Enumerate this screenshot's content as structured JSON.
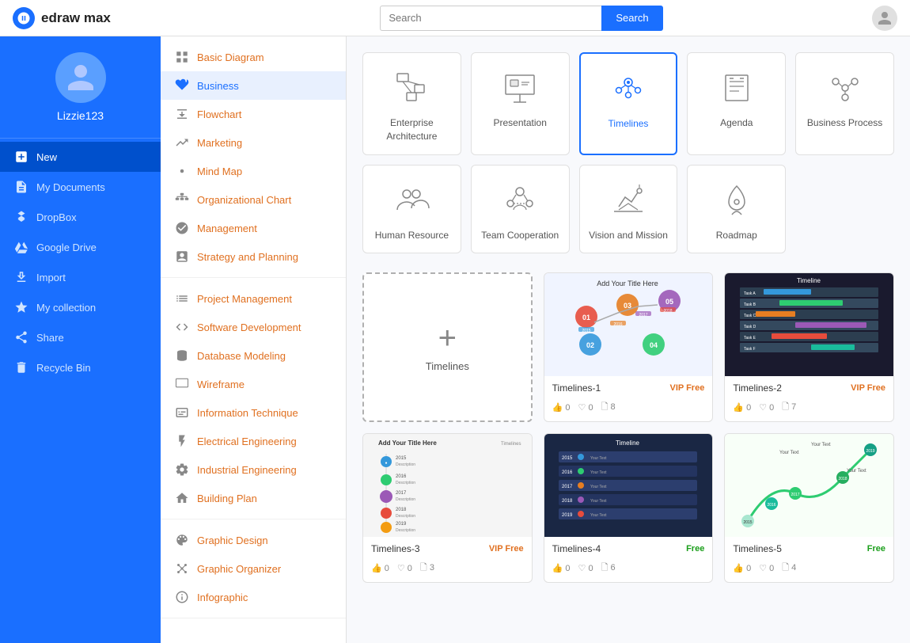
{
  "app": {
    "name": "edraw max",
    "logo_letter": "D"
  },
  "topbar": {
    "search_placeholder": "Search",
    "search_button_label": "Search"
  },
  "sidebar": {
    "username": "Lizzie123",
    "items": [
      {
        "id": "new",
        "label": "New",
        "active": true
      },
      {
        "id": "my-documents",
        "label": "My Documents",
        "active": false
      },
      {
        "id": "dropbox",
        "label": "DropBox",
        "active": false
      },
      {
        "id": "google-drive",
        "label": "Google Drive",
        "active": false
      },
      {
        "id": "import",
        "label": "Import",
        "active": false
      },
      {
        "id": "my-collection",
        "label": "My collection",
        "active": false
      },
      {
        "id": "share",
        "label": "Share",
        "active": false
      },
      {
        "id": "recycle-bin",
        "label": "Recycle Bin",
        "active": false
      }
    ]
  },
  "menu": {
    "sections": [
      {
        "items": [
          {
            "id": "basic-diagram",
            "label": "Basic Diagram",
            "active": false
          },
          {
            "id": "business",
            "label": "Business",
            "active": true
          },
          {
            "id": "flowchart",
            "label": "Flowchart",
            "active": false
          },
          {
            "id": "marketing",
            "label": "Marketing",
            "active": false
          },
          {
            "id": "mind-map",
            "label": "Mind Map",
            "active": false
          },
          {
            "id": "organizational-chart",
            "label": "Organizational Chart",
            "active": false
          },
          {
            "id": "management",
            "label": "Management",
            "active": false
          },
          {
            "id": "strategy-and-planning",
            "label": "Strategy and Planning",
            "active": false
          }
        ]
      },
      {
        "items": [
          {
            "id": "project-management",
            "label": "Project Management",
            "active": false
          },
          {
            "id": "software-development",
            "label": "Software Development",
            "active": false
          },
          {
            "id": "database-modeling",
            "label": "Database Modeling",
            "active": false
          },
          {
            "id": "wireframe",
            "label": "Wireframe",
            "active": false
          },
          {
            "id": "information-technique",
            "label": "Information Technique",
            "active": false
          },
          {
            "id": "electrical-engineering",
            "label": "Electrical Engineering",
            "active": false
          },
          {
            "id": "industrial-engineering",
            "label": "Industrial Engineering",
            "active": false
          },
          {
            "id": "building-plan",
            "label": "Building Plan",
            "active": false
          }
        ]
      },
      {
        "items": [
          {
            "id": "graphic-design",
            "label": "Graphic Design",
            "active": false
          },
          {
            "id": "graphic-organizer",
            "label": "Graphic Organizer",
            "active": false
          },
          {
            "id": "infographic",
            "label": "Infographic",
            "active": false
          }
        ]
      }
    ]
  },
  "categories": [
    {
      "id": "enterprise-architecture",
      "label": "Enterprise\nArchitecture",
      "selected": false
    },
    {
      "id": "presentation",
      "label": "Presentation",
      "selected": false
    },
    {
      "id": "timelines",
      "label": "Timelines",
      "selected": true
    },
    {
      "id": "agenda",
      "label": "Agenda",
      "selected": false
    },
    {
      "id": "business-process",
      "label": "Business Process",
      "selected": false
    },
    {
      "id": "human-resource",
      "label": "Human Resource",
      "selected": false
    },
    {
      "id": "team-cooperation",
      "label": "Team Cooperation",
      "selected": false
    },
    {
      "id": "vision-and-mission",
      "label": "Vision and Mission",
      "selected": false
    },
    {
      "id": "roadmap",
      "label": "Roadmap",
      "selected": false
    }
  ],
  "templates": {
    "add_label": "Timelines",
    "items": [
      {
        "id": "timelines-1",
        "name": "Timelines-1",
        "badge": "VIP Free",
        "badge_type": "vip",
        "likes": 0,
        "hearts": 0,
        "copies": 8
      },
      {
        "id": "timelines-2",
        "name": "Timelines-2",
        "badge": "VIP Free",
        "badge_type": "vip",
        "likes": 0,
        "hearts": 0,
        "copies": 7
      },
      {
        "id": "timelines-3",
        "name": "Timelines-3",
        "badge": "VIP Free",
        "badge_type": "vip",
        "likes": 0,
        "hearts": 0,
        "copies": 3
      },
      {
        "id": "timelines-4",
        "name": "Timelines-4",
        "badge": "Free",
        "badge_type": "free",
        "likes": 0,
        "hearts": 0,
        "copies": 6
      },
      {
        "id": "timelines-5",
        "name": "Timelines-5",
        "badge": "Free",
        "badge_type": "free",
        "likes": 0,
        "hearts": 0,
        "copies": 4
      }
    ]
  }
}
